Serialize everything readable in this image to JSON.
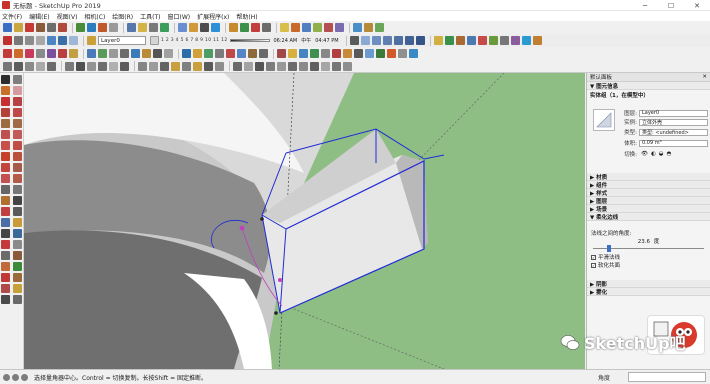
{
  "window": {
    "title": "无标题 - SketchUp Pro 2019",
    "minimize": "─",
    "maximize": "☐",
    "close": "✕"
  },
  "menu": [
    "文件(F)",
    "编辑(E)",
    "视图(V)",
    "相机(C)",
    "绘图(R)",
    "工具(T)",
    "窗口(W)",
    "扩展程序(x)",
    "帮助(H)"
  ],
  "toolbar": {
    "layer_value": "Layer0",
    "month_ruler": "1 2 3 4 5 6 7 8 9 10 11 12",
    "time_start": "06:24 AM",
    "time_noon": "中午",
    "time_end": "04:47 PM"
  },
  "tray": {
    "title": "默认面板",
    "close": "✕",
    "entity_section": "▼ 图元信息",
    "entity_name": "实体组（1，在模型中）",
    "layer_label": "图层:",
    "layer_value": "Layer0",
    "instance_label": "实例:",
    "instance_value": "立体外壳",
    "type_label": "类型:",
    "type_value": "类型: <undefined>",
    "volume_label": "体积:",
    "volume_value": "0.09 m³",
    "toggle_label": "切换:",
    "sections": [
      "▶ 材质",
      "▶ 组件",
      "▶ 样式",
      "▶ 图层",
      "▶ 场景"
    ],
    "soften_section": "▼ 柔化边线",
    "angle_label": "法线之间的角度:",
    "angle_value": "23.6",
    "angle_unit": "度",
    "angle_fraction": 0.14,
    "smooth_normals": "平滑法线",
    "soften_coplanar": "软化共面",
    "shadows_section": "▶ 阴影",
    "fog_section": "▶ 雾化"
  },
  "status": {
    "hint": "选择量角器中心。Control = 切换复制。长按Shift = 固定推断。",
    "measure_label": "角度"
  },
  "watermark": {
    "text": "SketchUp吧"
  },
  "colors": {
    "ground": "#8fbe85",
    "sky": "#d9d9d9",
    "selection": "#1f2bd6",
    "accent_red": "#cc2a27"
  }
}
